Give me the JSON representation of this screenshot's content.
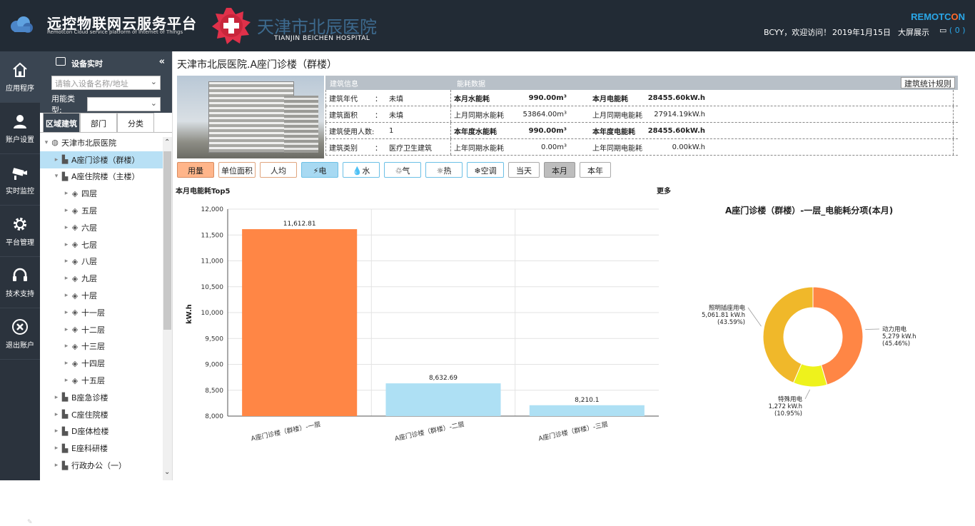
{
  "header": {
    "app_title": "远控物联网云服务平台",
    "app_subtitle": "Remotcon Cloud service platform of Internet of Things",
    "hospital_cn": "天津市北辰医院",
    "hospital_en": "TIANJIN BEICHEN HOSPITAL",
    "brand_a": "REMOTC",
    "brand_o": "O",
    "brand_b": "N",
    "welcome": "BCYY，欢迎访问！",
    "date": "2019年1月15日",
    "bigscreen": "大屏展示",
    "msg_count": "( 0 )"
  },
  "nav": [
    {
      "label": "应用程序",
      "icon": "home-icon"
    },
    {
      "label": "账户设置",
      "icon": "user-icon"
    },
    {
      "label": "实时监控",
      "icon": "camera-icon"
    },
    {
      "label": "平台管理",
      "icon": "gear-icon"
    },
    {
      "label": "技术支持",
      "icon": "headset-icon"
    },
    {
      "label": "退出账户",
      "icon": "logout-icon"
    }
  ],
  "tree_panel": {
    "title": "设备实时",
    "search_placeholder": "请输入设备名称/地址",
    "type_label": "用能类型:",
    "tabs": [
      "区域建筑",
      "部门",
      "分类"
    ],
    "nodes": [
      {
        "label": "天津市北辰医院",
        "level": 0,
        "toggle": "▾",
        "icon": "globe"
      },
      {
        "label": "A座门诊楼（群楼）",
        "level": 1,
        "toggle": "▸",
        "icon": "building",
        "selected": true
      },
      {
        "label": "A座住院楼（主楼）",
        "level": 1,
        "toggle": "▾",
        "icon": "building"
      },
      {
        "label": "四层",
        "level": 2,
        "toggle": "▸",
        "icon": "layers"
      },
      {
        "label": "五层",
        "level": 2,
        "toggle": "▸",
        "icon": "layers"
      },
      {
        "label": "六层",
        "level": 2,
        "toggle": "▸",
        "icon": "layers"
      },
      {
        "label": "七层",
        "level": 2,
        "toggle": "▸",
        "icon": "layers"
      },
      {
        "label": "八层",
        "level": 2,
        "toggle": "▸",
        "icon": "layers"
      },
      {
        "label": "九层",
        "level": 2,
        "toggle": "▸",
        "icon": "layers"
      },
      {
        "label": "十层",
        "level": 2,
        "toggle": "▸",
        "icon": "layers"
      },
      {
        "label": "十一层",
        "level": 2,
        "toggle": "▸",
        "icon": "layers"
      },
      {
        "label": "十二层",
        "level": 2,
        "toggle": "▸",
        "icon": "layers"
      },
      {
        "label": "十三层",
        "level": 2,
        "toggle": "▸",
        "icon": "layers"
      },
      {
        "label": "十四层",
        "level": 2,
        "toggle": "▸",
        "icon": "layers"
      },
      {
        "label": "十五层",
        "level": 2,
        "toggle": "▸",
        "icon": "layers"
      },
      {
        "label": "B座急诊楼",
        "level": 1,
        "toggle": "▸",
        "icon": "building"
      },
      {
        "label": "C座住院楼",
        "level": 1,
        "toggle": "▸",
        "icon": "building"
      },
      {
        "label": "D座体检楼",
        "level": 1,
        "toggle": "▸",
        "icon": "building"
      },
      {
        "label": "E座科研楼",
        "level": 1,
        "toggle": "▸",
        "icon": "building"
      },
      {
        "label": "行政办公（一）",
        "level": 1,
        "toggle": "▸",
        "icon": "building"
      }
    ]
  },
  "main": {
    "breadcrumb": "天津市北辰医院.A座门诊楼（群楼）",
    "info_head_building": "建筑信息",
    "info_head_energy": "能耗数据",
    "stat_rule_btn": "建筑统计规则",
    "building_rows": [
      {
        "k": "建筑年代",
        "c": "：",
        "v": "未填"
      },
      {
        "k": "建筑面积",
        "c": "：",
        "v": "未填"
      },
      {
        "k": "建筑使用人数:",
        "c": "",
        "v": "1"
      },
      {
        "k": "建筑类别",
        "c": "：",
        "v": "医疗卫生建筑"
      }
    ],
    "energy_rows": [
      {
        "k1": "本月水能耗",
        "v1": "990.00m³",
        "k2": "本月电能耗",
        "v2": "28455.60kW.h",
        "bold": true
      },
      {
        "k1": "上月同期水能耗",
        "v1": "53864.00m³",
        "k2": "上月同期电能耗",
        "v2": "27914.19kW.h",
        "bold": false
      },
      {
        "k1": "本年度水能耗",
        "v1": "990.00m³",
        "k2": "本年度电能耗",
        "v2": "28455.60kW.h",
        "bold": true
      },
      {
        "k1": "上年同期水能耗",
        "v1": "0.00m³",
        "k2": "上年同期电能耗",
        "v2": "0.00kW.h",
        "bold": false
      }
    ],
    "filters": [
      {
        "label": "用量",
        "style": "o",
        "w": 52
      },
      {
        "label": "单位面积",
        "style": "ob",
        "w": 52
      },
      {
        "label": "人均",
        "style": "ob",
        "w": 52
      },
      {
        "label": "⚡电",
        "style": "ba",
        "w": 52
      },
      {
        "label": "💧水",
        "style": "b",
        "w": 52
      },
      {
        "label": "♲气",
        "style": "b",
        "w": 52
      },
      {
        "label": "☼热",
        "style": "b",
        "w": 52
      },
      {
        "label": "❄空调",
        "style": "b",
        "w": 52
      },
      {
        "label": "当天",
        "style": "",
        "w": 44
      },
      {
        "label": "本月",
        "style": "g",
        "w": 44
      },
      {
        "label": "本年",
        "style": "",
        "w": 44
      }
    ],
    "bar_title": "本月电能耗Top5",
    "more": "更多",
    "donut_title": "A座门诊楼（群楼）-一层_电能耗分项(本月)"
  },
  "chart_data": [
    {
      "type": "bar",
      "title": "本月电能耗Top5",
      "ylabel": "kW.h",
      "categories": [
        "A座门诊楼（群楼）-一层",
        "A座门诊楼（群楼）-二层",
        "A座门诊楼（群楼）-三层"
      ],
      "values": [
        11612.81,
        8632.69,
        8210.1
      ],
      "value_labels": [
        "11,612.81",
        "8,632.69",
        "8,210.1"
      ],
      "colors": [
        "#ff8645",
        "#aee0f4",
        "#aee0f4"
      ],
      "ylim": [
        8000,
        12000
      ],
      "yticks": [
        "8,000",
        "8,500",
        "9,000",
        "9,500",
        "10,000",
        "10,500",
        "11,000",
        "11,500",
        "12,000"
      ],
      "grid": true
    },
    {
      "type": "pie",
      "title": "A座门诊楼（群楼）-一层_电能耗分项(本月)",
      "slices": [
        {
          "name": "动力用电",
          "value": 5279,
          "value_label": "5,279 kW.h",
          "pct": "(45.46%)",
          "color": "#ff8645"
        },
        {
          "name": "特殊用电",
          "value": 1272,
          "value_label": "1,272 kW.h",
          "pct": "(10.95%)",
          "color": "#eef21c"
        },
        {
          "name": "照明插座用电",
          "value": 5061.81,
          "value_label": "5,061.81 kW.h",
          "pct": "(43.59%)",
          "color": "#f0b82a"
        }
      ]
    }
  ]
}
